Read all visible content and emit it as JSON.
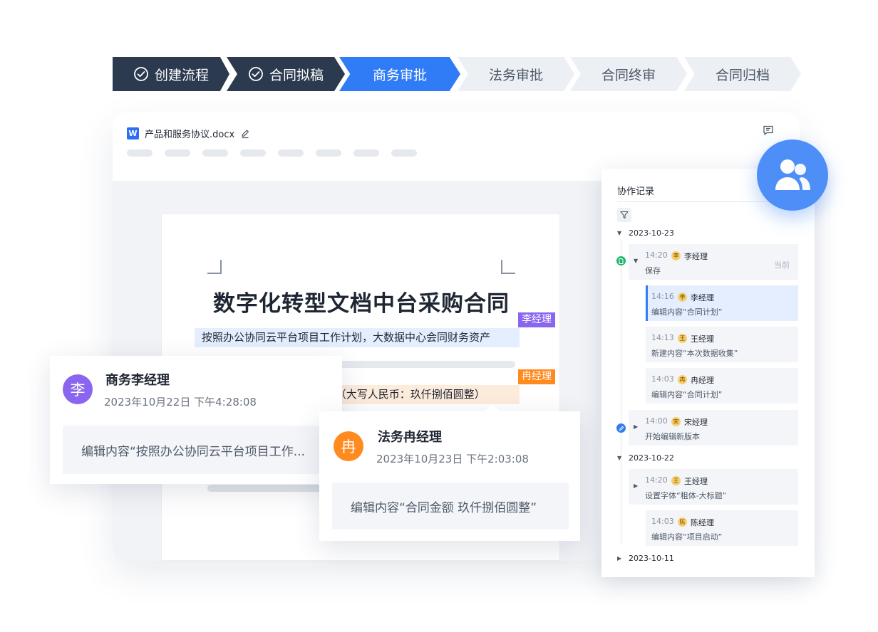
{
  "steps": [
    {
      "label": "创建流程",
      "state": "done"
    },
    {
      "label": "合同拟稿",
      "state": "done"
    },
    {
      "label": "商务审批",
      "state": "active"
    },
    {
      "label": "法务审批",
      "state": "todo"
    },
    {
      "label": "合同终审",
      "state": "todo"
    },
    {
      "label": "合同归档",
      "state": "todo"
    }
  ],
  "document": {
    "file_icon": "W",
    "file_name": "产品和服务协议.docx",
    "title": "数字化转型文档中台采购合同",
    "highlight_1": "按照办公协同云平台项目工作计划，大数据中心会同财务资产",
    "highlight_2": "元 （大写人民币：玖仟捌佰圆整）",
    "tag_li": "李经理",
    "tag_ran": "冉经理"
  },
  "cards": {
    "li": {
      "avatar": "李",
      "name": "商务李经理",
      "time": "2023年10月22日 下午4:28:08",
      "content": "编辑内容“按照办公协同云平台项目工作..."
    },
    "ran": {
      "avatar": "冉",
      "name": "法务冉经理",
      "time": "2023年10月23日 下午2:03:08",
      "content": "编辑内容“合同金额 玖仟捌佰圆整”"
    }
  },
  "panel": {
    "title": "协作记录",
    "groups": [
      {
        "date": "2023-10-23"
      },
      {
        "date": "2023-10-22"
      },
      {
        "date": "2023-10-11"
      }
    ],
    "entries": [
      {
        "time": "14:20",
        "avatar": "李",
        "name": "李经理",
        "desc": "保存",
        "badge": "当前"
      },
      {
        "time": "14:16",
        "avatar": "李",
        "name": "李经理",
        "desc": "编辑内容“合同计划”"
      },
      {
        "time": "14:13",
        "avatar": "王",
        "name": "王经理",
        "desc": "新建内容“本次数据收集”"
      },
      {
        "time": "14:03",
        "avatar": "冉",
        "name": "冉经理",
        "desc": "编辑内容“合同计划”"
      },
      {
        "time": "14:00",
        "avatar": "宋",
        "name": "宋经理",
        "desc": "开始编辑新版本"
      },
      {
        "time": "14:20",
        "avatar": "王",
        "name": "王经理",
        "desc": "设置字体“粗体-大标题”"
      },
      {
        "time": "14:03",
        "avatar": "陈",
        "name": "陈经理",
        "desc": "编辑内容“项目启动”"
      }
    ]
  },
  "icons": {
    "check": "check-circle-icon",
    "edit": "pencil-icon",
    "comment": "comment-icon",
    "filter": "filter-icon",
    "team": "users-icon",
    "save_marker": "document-icon",
    "edit_marker": "edit-icon"
  },
  "colors": {
    "done_step": "#2b3a4f",
    "active_step": "#2f7cf6",
    "todo_step": "#eceff4",
    "li_accent": "#8a66f0",
    "ran_accent": "#ff8a1e"
  }
}
